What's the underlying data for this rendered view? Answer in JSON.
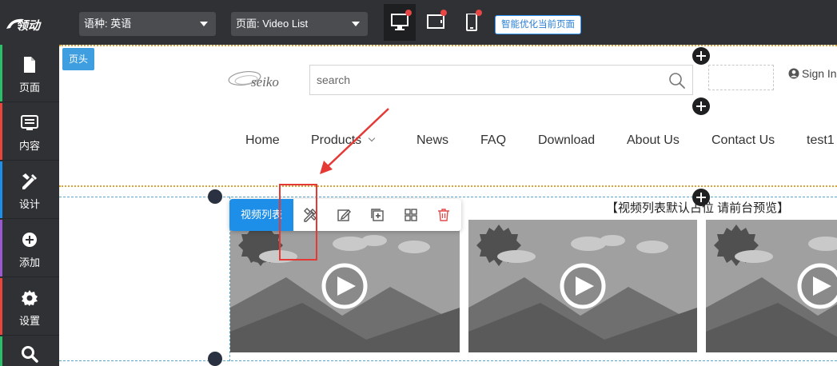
{
  "topbar": {
    "language_label": "语种: 英语",
    "page_label": "页面: Video List",
    "devices": [
      "desktop-device",
      "tablet-device",
      "mobile-device"
    ],
    "optimize_button": "智能优化当前页面"
  },
  "sidebar": {
    "items": [
      {
        "label": "页面",
        "icon": "file-icon",
        "color": "#2bbf6a"
      },
      {
        "label": "内容",
        "icon": "content-icon",
        "color": "#e8453c"
      },
      {
        "label": "设计",
        "icon": "design-icon",
        "color": "#1e8fe8"
      },
      {
        "label": "添加",
        "icon": "add-icon",
        "color": "#9b59d0"
      },
      {
        "label": "设置",
        "icon": "settings-icon",
        "color": "#e8453c"
      },
      {
        "label": "",
        "icon": "search-icon",
        "color": "#2bbf6a"
      }
    ]
  },
  "canvas": {
    "header_tag": "页头",
    "search_placeholder": "search",
    "sign_in": "Sign In",
    "nav": [
      "Home",
      "Products",
      "News",
      "FAQ",
      "Download",
      "About Us",
      "Contact Us",
      "test1"
    ],
    "module_label": "视频列表",
    "module_title": "【视频列表默认占位 请前台预览】"
  },
  "colors": {
    "topbar_bg": "#2f3134",
    "accent_blue": "#1e8fe8",
    "header_border": "#d9a23a",
    "highlight_red": "#e53935"
  }
}
